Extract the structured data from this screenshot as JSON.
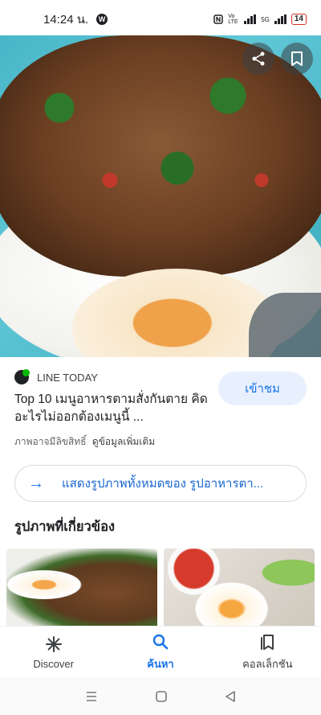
{
  "status_bar": {
    "time": "14:24 น.",
    "app_icon": "W",
    "network_label_1": "Vo LTE",
    "network_label_2": "5G",
    "battery": "14"
  },
  "hero": {
    "share_icon": "share-icon",
    "save_icon": "bookmark-icon"
  },
  "result": {
    "source_name": "LINE TODAY",
    "title": "Top 10 เมนูอาหารตามสั่งกันตาย คิดอะไรไม่ออกต้องเมนูนี้ ...",
    "copyright": "ภาพอาจมีลิขสิทธิ์",
    "more_info": "ดูข้อมูลเพิ่มเติม",
    "visit_label": "เข้าชม",
    "show_all_label": "แสดงรูปภาพทั้งหมดของ รูปอาหารตา..."
  },
  "related": {
    "heading": "รูปภาพที่เกี่ยวข้อง"
  },
  "bottom_nav": {
    "items": [
      {
        "label": "Discover",
        "icon": "asterisk-icon"
      },
      {
        "label": "ค้นหา",
        "icon": "search-icon"
      },
      {
        "label": "คอลเล็กชัน",
        "icon": "collections-icon"
      }
    ],
    "active_index": 1
  },
  "colors": {
    "accent": "#1a73e8",
    "visit_bg": "#e8f0fe"
  }
}
